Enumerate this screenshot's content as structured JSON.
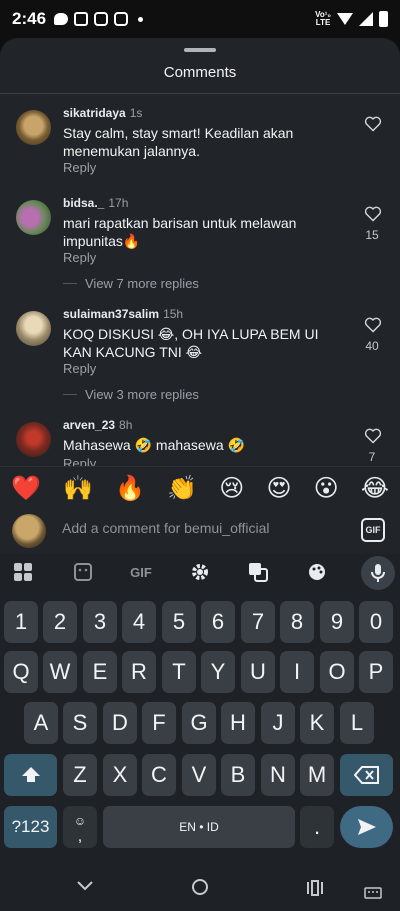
{
  "status_bar": {
    "time": "2:46",
    "network_top": "Vo¹₀",
    "network_bottom": "LTE"
  },
  "sheet": {
    "title": "Comments"
  },
  "comments": [
    {
      "user": "sikatridaya",
      "time": "1s",
      "text": "Stay calm, stay smart! Keadilan akan menemukan jalannya.",
      "reply": "Reply",
      "likes": ""
    },
    {
      "user": "bidsa._",
      "time": "17h",
      "text": "mari rapatkan barisan untuk melawan impunitas🔥",
      "reply": "Reply",
      "likes": "15",
      "view_more": "View 7 more replies"
    },
    {
      "user": "sulaiman37salim",
      "time": "15h",
      "text": "KOQ DISKUSI 😂, OH IYA LUPA BEM UI KAN KACUNG TNI 😂",
      "reply": "Reply",
      "likes": "40",
      "view_more": "View 3 more replies"
    },
    {
      "user": "arven_23",
      "time": "8h",
      "text": "Mahasewa 🤣 mahasewa 🤣",
      "reply": "Reply",
      "likes": "7"
    }
  ],
  "emoji_bar": [
    "❤️",
    "🙌",
    "🔥",
    "👏",
    "😢",
    "😍",
    "😮",
    "😂"
  ],
  "comment_input": {
    "placeholder": "Add a comment for bemui_official",
    "gif_label": "GIF"
  },
  "keyboard": {
    "toolbar": {
      "gif_label": "GIF"
    },
    "row_numbers": [
      "1",
      "2",
      "3",
      "4",
      "5",
      "6",
      "7",
      "8",
      "9",
      "0"
    ],
    "row1": [
      "Q",
      "W",
      "E",
      "R",
      "T",
      "Y",
      "U",
      "I",
      "O",
      "P"
    ],
    "row2": [
      "A",
      "S",
      "D",
      "F",
      "G",
      "H",
      "J",
      "K",
      "L"
    ],
    "row3": [
      "Z",
      "X",
      "C",
      "V",
      "B",
      "N",
      "M"
    ],
    "symbols_key": "?123",
    "comma_key": ",",
    "space_label": "EN • ID",
    "period_key": "."
  }
}
